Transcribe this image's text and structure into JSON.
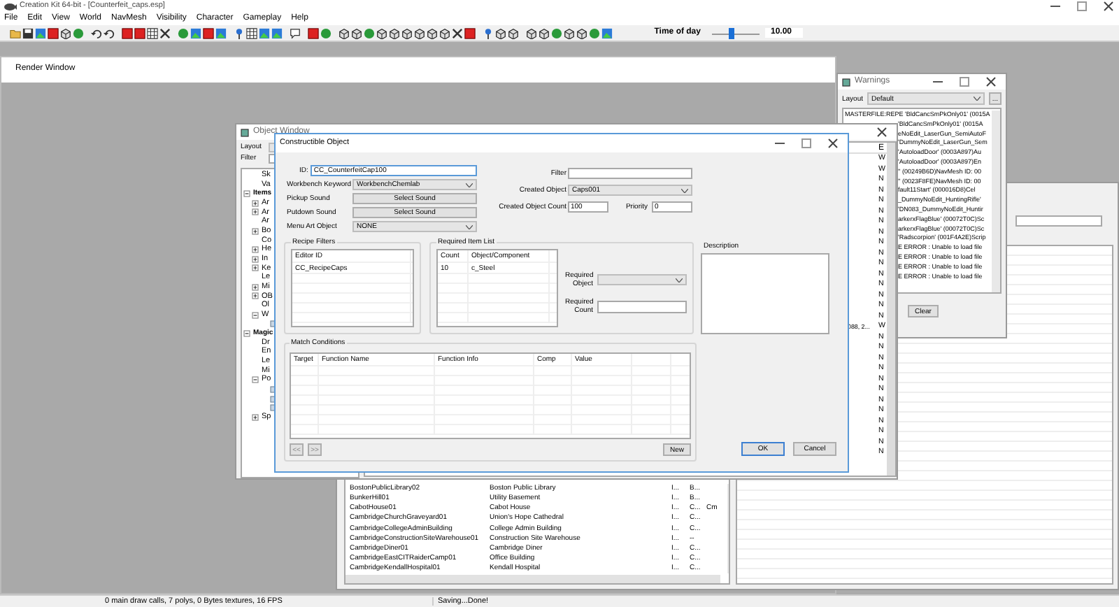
{
  "app_title": "Creation Kit 64-bit - [Counterfeit_caps.esp]",
  "menu": [
    "File",
    "Edit",
    "View",
    "World",
    "NavMesh",
    "Visibility",
    "Character",
    "Gameplay",
    "Help"
  ],
  "time_of_day": {
    "label": "Time of day",
    "level": 0.42,
    "reading": "10.00"
  },
  "render_window": {
    "title": "Render Window"
  },
  "cell_view": {
    "rows": [
      [
        "BostonPublicLibrary02",
        "Boston Public Library",
        "I...",
        "B...",
        ""
      ],
      [
        "BunkerHill01",
        "Utility Basement",
        "I...",
        "B...",
        ""
      ],
      [
        "CabotHouse01",
        "Cabot House",
        "I...",
        "C...",
        "Cm"
      ],
      [
        "CambridgeChurchGraveyard01",
        "Union's Hope Cathedral",
        "I...",
        "C...",
        ""
      ],
      [
        "CambridgeCollegeAdminBuilding",
        "College Admin Building",
        "I...",
        "C...",
        ""
      ],
      [
        "CambridgeConstructionSiteWarehouse01",
        "Construction Site Warehouse",
        "I...",
        "--",
        ""
      ],
      [
        "CambridgeDiner01",
        "Cambridge Diner",
        "I...",
        "C...",
        ""
      ],
      [
        "CambridgeEastCITRaiderCamp01",
        "Office Building",
        "I...",
        "C...",
        ""
      ],
      [
        "CambridgeKendallHospital01",
        "Kendall Hospital",
        "I...",
        "C...",
        ""
      ]
    ]
  },
  "warnings": {
    "title": "Warnings",
    "layout_label": "Layout",
    "layout_value": "Default",
    "more_button": "...",
    "clear_button": "Clear",
    "lines": [
      {
        "text": "MASTERFILE:REPE 'BldCancSmPkOnly01' (0015A",
        "clipped": false
      },
      {
        "text": "'BldCancSmPkOnly01' (0015A",
        "clipped": true
      },
      {
        "text": "eNoEdit_LaserGun_SemiAutoF",
        "clipped": true
      },
      {
        "text": "'DummyNoEdit_LaserGun_Sem",
        "clipped": true
      },
      {
        "text": "'AutoloadDoor' (0003A897)Au",
        "clipped": true
      },
      {
        "text": "'AutoloadDoor' (0003A897)En",
        "clipped": true
      },
      {
        "text": "'' (00249B6D)NavMesh ID: 00",
        "clipped": true
      },
      {
        "text": "'' (0023F8FE)NavMesh ID: 00",
        "clipped": true
      },
      {
        "text": "fault11Start' (000016D8)Cel",
        "clipped": true
      },
      {
        "text": "_DummyNoEdit_HuntingRifle'",
        "clipped": true
      },
      {
        "text": "'DN083_DummyNoEdit_Huntir",
        "clipped": true
      },
      {
        "text": "arkerxFlagBlue' (00072T0C)Sc",
        "clipped": true
      },
      {
        "text": "arkerxFlagBlue' (00072T0C)Sc",
        "clipped": true
      },
      {
        "text": "'Radscorpion' (001F4A2E)Scrip",
        "clipped": true
      },
      {
        "text": "E ERROR : Unable to load file",
        "clipped": true
      },
      {
        "text": "E ERROR : Unable to load file",
        "clipped": true
      },
      {
        "text": "E ERROR : Unable to load file",
        "clipped": true
      },
      {
        "text": "E ERROR : Unable to load file",
        "clipped": true
      }
    ]
  },
  "object_window": {
    "title": "Object Window",
    "layout_label": "Layout",
    "filter_label": "Filter",
    "tree": [
      {
        "children": [
          {
            "label": "Sk"
          },
          {
            "label": "Va"
          }
        ]
      },
      {
        "label": "Items",
        "expanded": true,
        "children": [
          {
            "label": "Ar",
            "expanded": false
          },
          {
            "label": "Ar",
            "expanded": false
          },
          {
            "label": "Ar"
          },
          {
            "label": "Bo",
            "expanded": false
          },
          {
            "label": "Co"
          },
          {
            "label": "He",
            "expanded": false
          },
          {
            "label": "In",
            "expanded": false
          },
          {
            "label": "Ke",
            "expanded": false
          },
          {
            "label": "Le"
          },
          {
            "label": "Mi",
            "expanded": false
          },
          {
            "label": "OB",
            "expanded": false
          },
          {
            "label": "Ol"
          },
          {
            "label": "W",
            "expanded": true,
            "children": [
              {
                "kind": "icon"
              }
            ]
          }
        ]
      },
      {
        "label": "Magic",
        "expanded": true,
        "children": [
          {
            "label": "Dr"
          },
          {
            "label": "En"
          },
          {
            "label": "Le"
          },
          {
            "label": "Mi"
          },
          {
            "label": "Po",
            "expanded": true,
            "children": [
              {
                "kind": "icon"
              },
              {
                "kind": "icon"
              },
              {
                "kind": "icon"
              }
            ]
          },
          {
            "label": "Sp",
            "expanded": false
          }
        ]
      }
    ],
    "list_header": "E",
    "list_rows": [
      [
        "",
        "W"
      ],
      [
        "",
        "W"
      ],
      [
        "",
        "N"
      ],
      [
        "",
        "N"
      ],
      [
        "",
        "N"
      ],
      [
        "",
        "N"
      ],
      [
        "",
        "N"
      ],
      [
        "",
        "N"
      ],
      [
        "",
        "N"
      ],
      [
        "",
        "N"
      ],
      [
        "",
        "N"
      ],
      [
        "",
        "N"
      ],
      [
        "",
        "N"
      ],
      [
        "",
        "N"
      ],
      [
        "",
        "N"
      ],
      [
        "",
        "N"
      ],
      [
        "088, 2...",
        "W"
      ],
      [
        "",
        "N"
      ],
      [
        "",
        "N"
      ],
      [
        "",
        "N"
      ],
      [
        "",
        "N"
      ],
      [
        "",
        "N"
      ],
      [
        "",
        "N"
      ],
      [
        "",
        "N"
      ],
      [
        "",
        "N"
      ],
      [
        "",
        "N"
      ],
      [
        "",
        "N"
      ],
      [
        "",
        "N"
      ],
      [
        "",
        "N"
      ]
    ]
  },
  "dialog": {
    "title": "Constructible Object",
    "id": {
      "label": "ID:",
      "value": "CC_CounterfeitCap100"
    },
    "left_rows": [
      {
        "kind": "combo",
        "label": "Workbench Keyword",
        "value": "WorkbenchChemlab"
      },
      {
        "kind": "button",
        "label": "Pickup Sound",
        "value": "Select Sound"
      },
      {
        "kind": "button",
        "label": "Putdown Sound",
        "value": "Select Sound"
      },
      {
        "kind": "combo",
        "label": "Menu Art Object",
        "value": "NONE"
      }
    ],
    "filter": {
      "label": "Filter"
    },
    "created_object": {
      "label": "Created Object",
      "value": "Caps001"
    },
    "created_object_count": {
      "label": "Created Object Count",
      "value": "100"
    },
    "priority": {
      "label": "Priority",
      "value": "0"
    },
    "recipe_filters": {
      "title": "Recipe Filters",
      "columns": [
        "Editor ID"
      ],
      "rows": [
        [
          "CC_RecipeCaps"
        ]
      ]
    },
    "required_items": {
      "title": "Required Item List",
      "columns": [
        "Count",
        "Object/Component"
      ],
      "rows": [
        [
          "10",
          "c_Steel"
        ]
      ],
      "required_object_label": "Required Object",
      "required_count_label": "Required Count"
    },
    "description": {
      "label": "Description"
    },
    "match_conditions": {
      "title": "Match Conditions",
      "columns": [
        "Target",
        "Function Name",
        "Function Info",
        "Comp",
        "Value"
      ],
      "prev_button": "<<",
      "next_button": ">>",
      "new_button": "New"
    },
    "buttons": [
      "OK",
      "Cancel"
    ]
  },
  "status_bar": [
    "0 main draw calls, 7 polys, 0 Bytes textures, 16 FPS",
    "Saving...Done!"
  ]
}
